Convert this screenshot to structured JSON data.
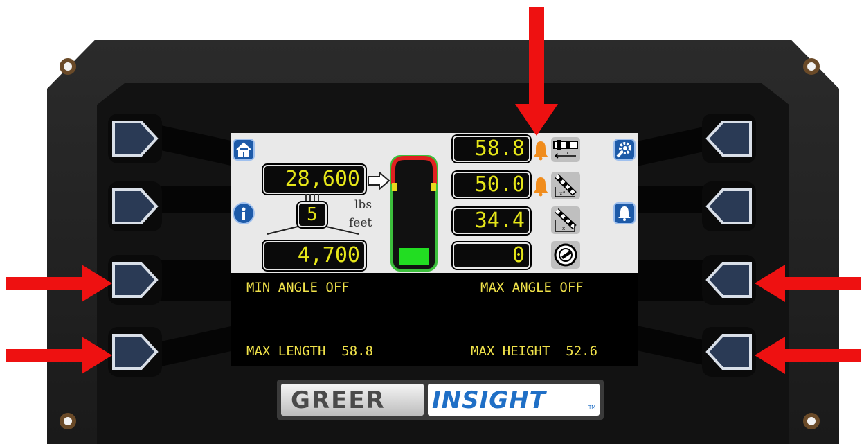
{
  "screen": {
    "load": {
      "value": "28,600",
      "unit": "lbs"
    },
    "parts_of_line": {
      "value": "5",
      "unit": "feet"
    },
    "capacity": {
      "value": "4,700"
    },
    "readouts": [
      {
        "name": "length",
        "value": "58.8",
        "alarm": true,
        "icon": "boom-length-icon"
      },
      {
        "name": "angle",
        "value": "50.0",
        "alarm": true,
        "icon": "boom-angle-icon"
      },
      {
        "name": "radius",
        "value": "34.4",
        "alarm": false,
        "icon": "boom-radius-icon"
      },
      {
        "name": "swing",
        "value": "0",
        "alarm": false,
        "icon": "swing-icon"
      }
    ],
    "load_gauge": {
      "fill_fraction": 0.16,
      "colors": {
        "green": "#3cbf3c",
        "yellow": "#e8d81c",
        "red": "#e02020"
      }
    },
    "softkeys": {
      "left_1": "MIN ANGLE OFF",
      "right_1": "MAX ANGLE OFF",
      "left_2": "MAX LENGTH  58.8",
      "right_2": "MAX HEIGHT  52.6"
    }
  },
  "brand": {
    "word1": "GREER",
    "word2": "INSIGHT",
    "tm": "TM"
  },
  "colors": {
    "text_yellow": "#e6e619",
    "alarm_orange": "#f08c1c",
    "nav_blue": "#1d5aa8",
    "arrow_red": "#ee1111"
  }
}
